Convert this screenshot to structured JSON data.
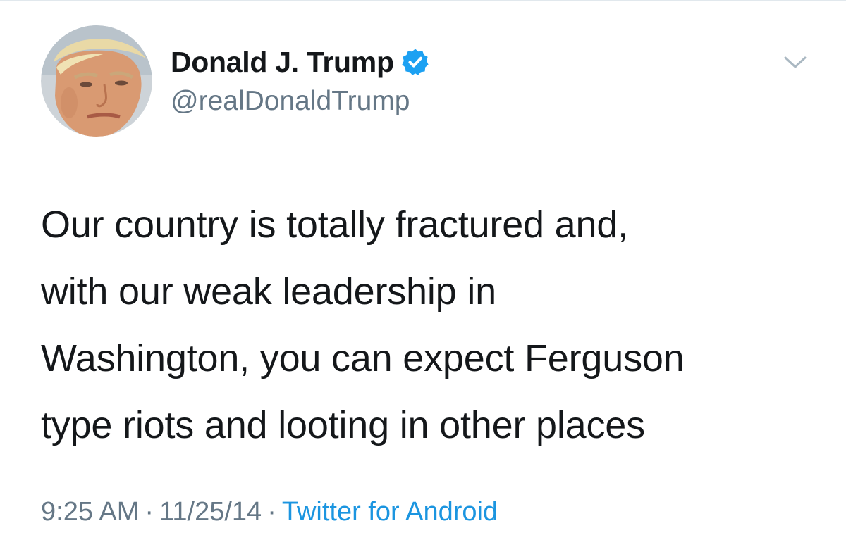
{
  "tweet": {
    "author": {
      "display_name": "Donald J. Trump",
      "handle": "@realDonaldTrump",
      "verified": true,
      "avatar_icon": "profile-photo"
    },
    "text_lines": [
      "Our country is totally fractured and,",
      "with our weak leadership in",
      "Washington, you can expect Ferguson",
      "type riots and looting in other places"
    ],
    "time": "9:25 AM",
    "date": "11/25/14",
    "separator": "·",
    "source": "Twitter for Android",
    "menu_icon": "chevron-down-icon"
  },
  "colors": {
    "text": "#14171a",
    "secondary": "#657786",
    "link": "#1b95e0",
    "verified": "#1da1f2",
    "divider": "#e1e8ed"
  }
}
